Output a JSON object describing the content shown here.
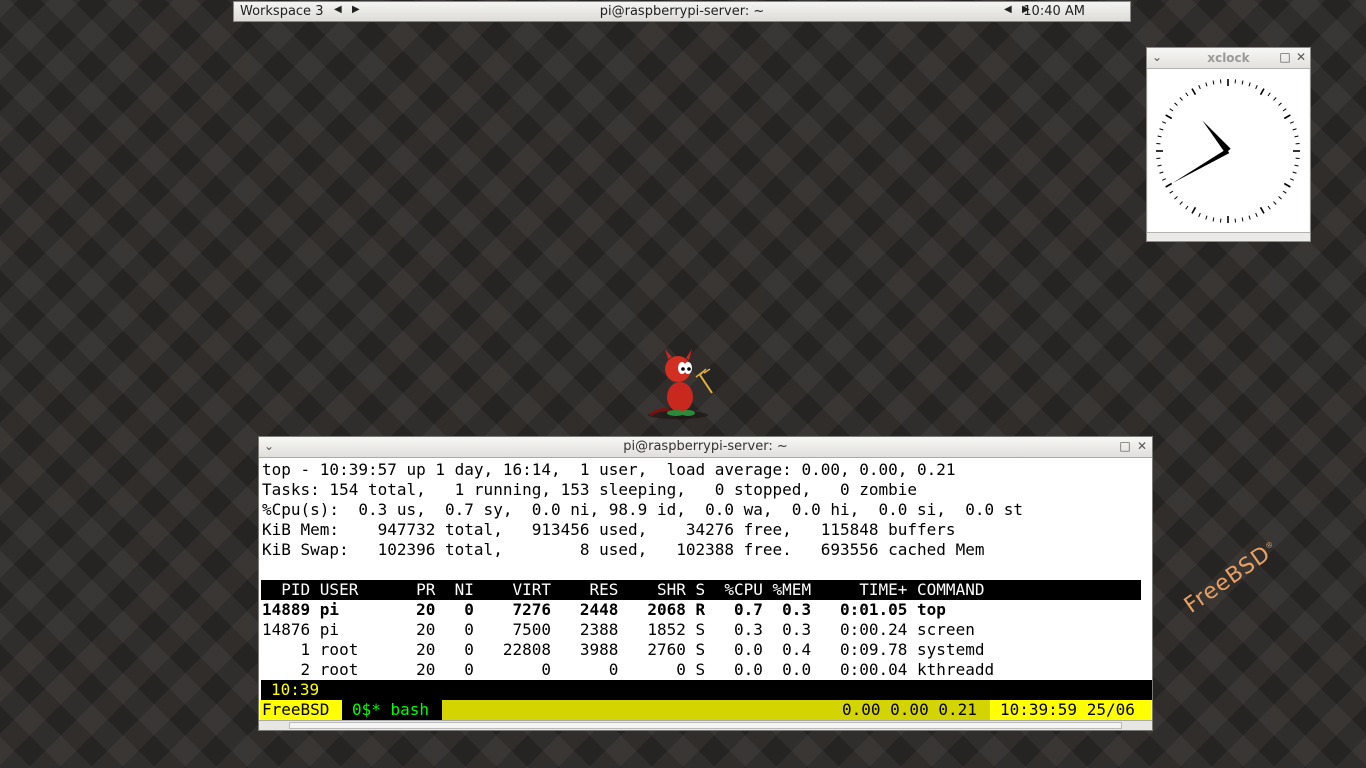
{
  "panel": {
    "workspace": "Workspace 3",
    "title": "pi@raspberrypi-server: ~",
    "clock": "10:40 AM"
  },
  "xclock": {
    "title": "xclock",
    "hour": 10,
    "minute": 40
  },
  "wallpaper": {
    "brand": "FreeBSD",
    "brand_color": "#e8a066"
  },
  "terminal": {
    "title": "pi@raspberrypi-server: ~",
    "summary": [
      "top - 10:39:57 up 1 day, 16:14,  1 user,  load average: 0.00, 0.00, 0.21",
      "Tasks: 154 total,   1 running, 153 sleeping,   0 stopped,   0 zombie",
      "%Cpu(s):  0.3 us,  0.7 sy,  0.0 ni, 98.9 id,  0.0 wa,  0.0 hi,  0.0 si,  0.0 st",
      "KiB Mem:    947732 total,   913456 used,    34276 free,   115848 buffers",
      "KiB Swap:   102396 total,        8 used,   102388 free.   693556 cached Mem"
    ],
    "table_header": "  PID USER      PR  NI    VIRT    RES    SHR S  %CPU %MEM     TIME+ COMMAND",
    "rows": [
      "14889 pi        20   0    7276   2448   2068 R   0.7  0.3   0:01.05 top",
      "14876 pi        20   0    7500   2388   1852 S   0.3  0.3   0:00.24 screen",
      "    1 root      20   0   22808   3988   2760 S   0.0  0.4   0:09.78 systemd",
      "    2 root      20   0       0      0      0 S   0.0  0.0   0:00.04 kthreadd"
    ],
    "caption": "10:39",
    "status": {
      "session": "FreeBSD",
      "window": "0$* bash",
      "load": "0.00 0.00 0.21",
      "datetime": "10:39:59 25/06"
    },
    "colors": {
      "status_bar": "#d4d400",
      "highlight": "#ffff00",
      "window_text": "#00ff00"
    }
  }
}
